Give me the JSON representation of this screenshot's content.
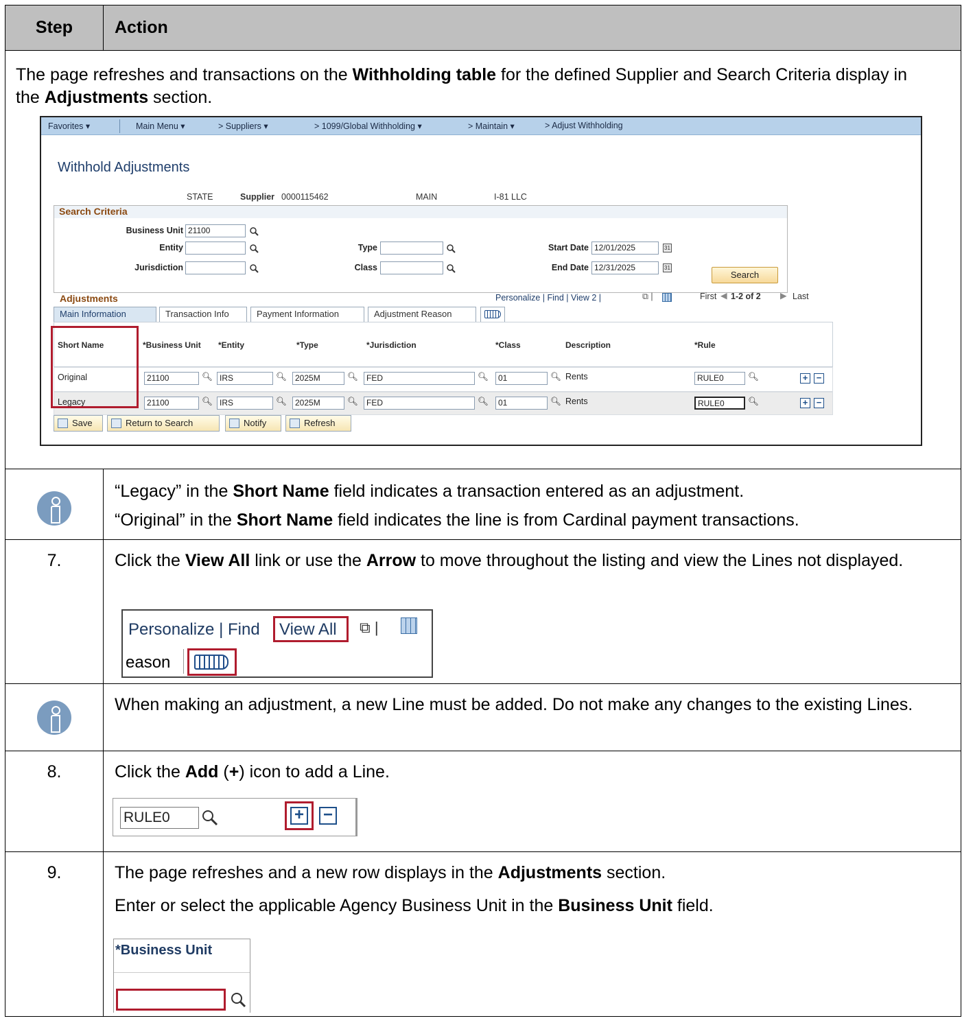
{
  "header": {
    "step": "Step",
    "action": "Action"
  },
  "intro": {
    "p1": "The page refreshes and transactions on the ",
    "b1": "Withholding table",
    "p2": " for the defined Supplier and Search Criteria display in the ",
    "b2": "Adjustments",
    "p3": " section."
  },
  "ps": {
    "nav": [
      "Favorites ▾",
      "Main Menu ▾",
      ">  Suppliers ▾",
      ">  1099/Global Withholding ▾",
      ">  Maintain ▾",
      ">  Adjust Withholding"
    ],
    "page_title": "Withhold Adjustments",
    "setid": "STATE",
    "supplier_label": "Supplier",
    "supplier_id": "0000115462",
    "location": "MAIN",
    "supplier_name": "I-81 LLC",
    "search_criteria": "Search Criteria",
    "bu_label": "Business Unit",
    "bu_value": "21100",
    "entity_label": "Entity",
    "jurisdiction_label": "Jurisdiction",
    "type_label": "Type",
    "class_label": "Class",
    "start_label": "Start Date",
    "start_value": "12/01/2025",
    "end_label": "End Date",
    "end_value": "12/31/2025",
    "search_btn": "Search",
    "adjustments": "Adjustments",
    "grid_tools": "Personalize | Find | View 2 | ",
    "grid_nav": {
      "first": "First",
      "range": "1-2 of 2",
      "last": "Last"
    },
    "tabs": [
      "Main Information",
      "Transaction Info",
      "Payment Information",
      "Adjustment Reason"
    ],
    "columns": [
      "Short Name",
      "*Business Unit",
      "*Entity",
      "*Type",
      "*Jurisdiction",
      "*Class",
      "Description",
      "*Rule"
    ],
    "rows": [
      {
        "short_name": "Original",
        "bu": "21100",
        "entity": "IRS",
        "type": "2025M",
        "jurisdiction": "FED",
        "class": "01",
        "description": "Rents",
        "rule": "RULE0"
      },
      {
        "short_name": "Legacy",
        "bu": "21100",
        "entity": "IRS",
        "type": "2025M",
        "jurisdiction": "FED",
        "class": "01",
        "description": "Rents",
        "rule": "RULE0"
      }
    ],
    "buttons": [
      "Save",
      "Return to Search",
      "Notify",
      "Refresh"
    ]
  },
  "info1": {
    "l1a": "“Legacy” in the ",
    "l1b": "Short Name",
    "l1c": " field indicates a transaction entered as an adjustment.",
    "l2a": "“Original” in the ",
    "l2b": "Short Name",
    "l2c": " field indicates the line is from Cardinal payment transactions."
  },
  "step7": {
    "num": "7.",
    "a": "Click the ",
    "b": "View All",
    "c": " link or use the ",
    "d": "Arrow",
    "e": " to move throughout the listing and view the Lines not displayed.",
    "crop_personalize": "Personalize | Find ",
    "crop_viewall": "View All",
    "crop_eason": "eason"
  },
  "info2": {
    "text": "When making an adjustment, a new Line must be added. Do not make any changes to the existing Lines."
  },
  "step8": {
    "num": "8.",
    "a": "Click the ",
    "b": "Add",
    "c": " (",
    "d": "+",
    "e": ") icon to add a Line.",
    "crop_rule": "RULE0"
  },
  "step9": {
    "num": "9.",
    "p1a": "The page refreshes and a new row displays in the ",
    "p1b": "Adjustments",
    "p1c": " section.",
    "p2a": "Enter or select the applicable Agency Business Unit in the ",
    "p2b": "Business Unit",
    "p2c": " field.",
    "crop_label": "*Business Unit"
  },
  "colors": {
    "header_bg": "#bfbfbf",
    "info_icon": "#7b9cbf",
    "highlight": "#b01c2e",
    "nav_bar": "#b7d1ea"
  }
}
